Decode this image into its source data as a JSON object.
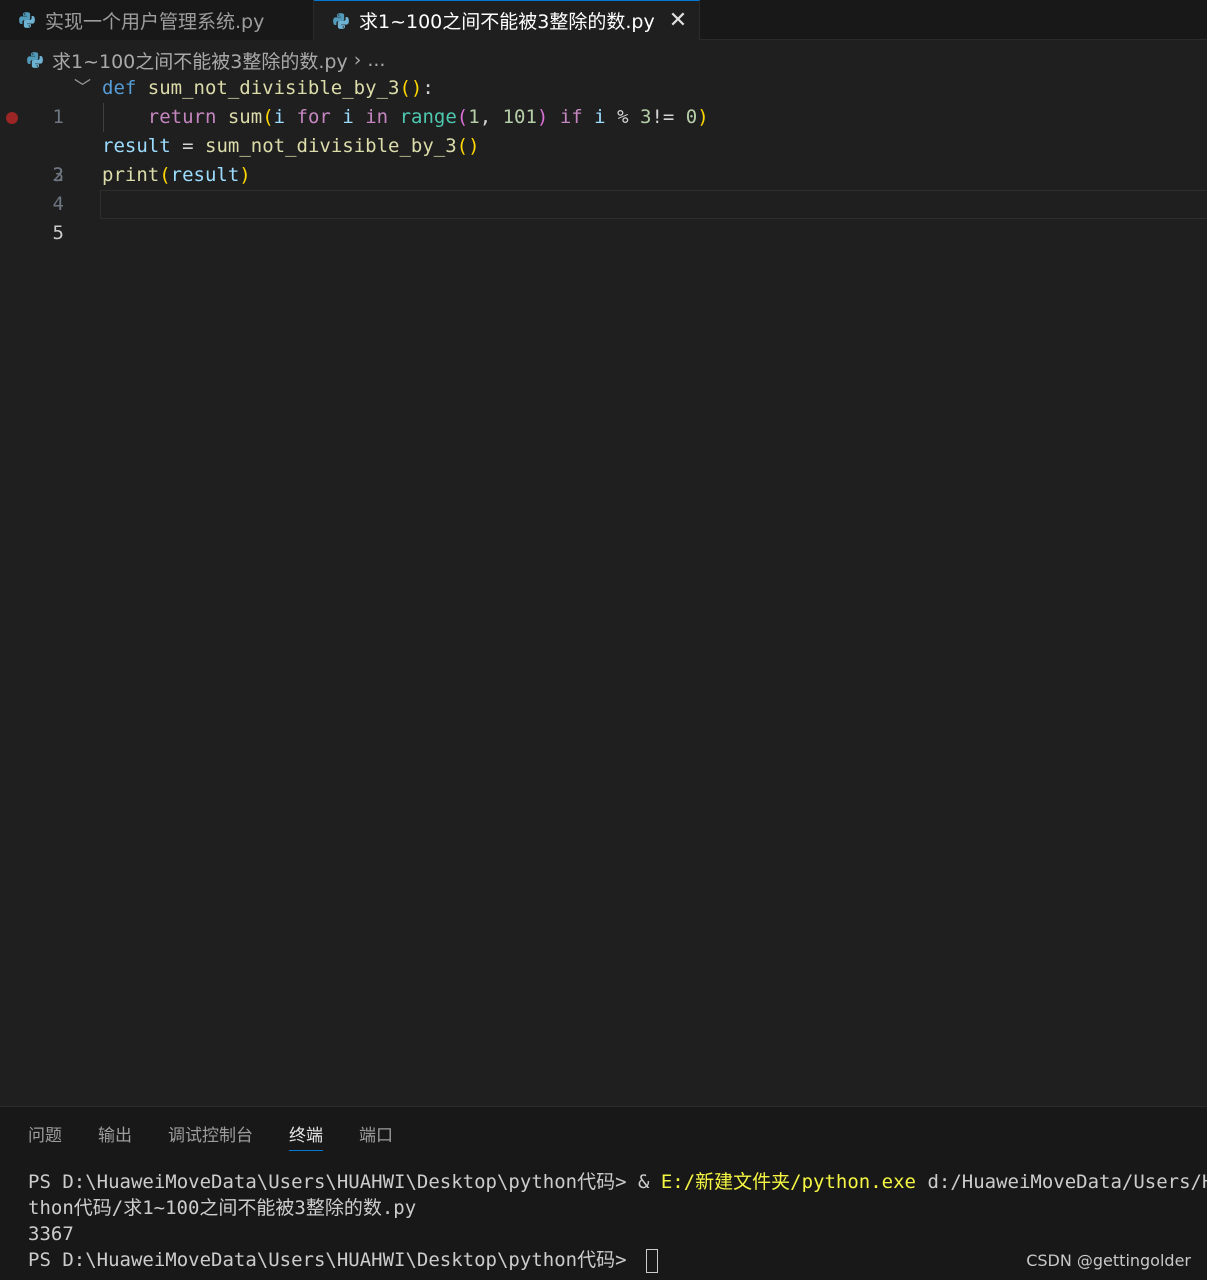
{
  "tabs": [
    {
      "label": "实现一个用户管理系统.py",
      "active": false
    },
    {
      "label": "求1~100之间不能被3整除的数.py",
      "active": true,
      "close_glyph": "✕"
    }
  ],
  "breadcrumb": {
    "file": "求1~100之间不能被3整除的数.py",
    "separator": "›",
    "more": "..."
  },
  "editor": {
    "line_numbers": [
      "1",
      "2",
      "3",
      "4",
      "5"
    ],
    "breakpoint_line": 2,
    "tokens": {
      "def": "def",
      "func_name": "sum_not_divisible_by_3",
      "paren_open": "(",
      "paren_close": ")",
      "colon": ":",
      "return": "return",
      "sum": "sum",
      "i": "i",
      "for": "for",
      "in": "in",
      "range": "range",
      "one": "1",
      "comma": ",",
      "hundred_one": "101",
      "if": "if",
      "mod": "%",
      "three": "3",
      "neq": "!=",
      "zero": "0",
      "result": "result",
      "eq": "=",
      "print": "print"
    }
  },
  "panel": {
    "tabs": [
      "问题",
      "输出",
      "调试控制台",
      "终端",
      "端口"
    ],
    "active_tab": "终端",
    "terminal": {
      "prompt": "PS D:\\HuaweiMoveData\\Users\\HUAHWI\\Desktop\\python代码> ",
      "cmd_amp": "& ",
      "cmd_exe": "E:/新建文件夹/python.exe",
      "cmd_arg": " d:/HuaweiMoveData/Users/HUAHWI/Desktop/py",
      "cmd_wrap": "thon代码/求1~100之间不能被3整除的数.py",
      "output": "3367",
      "prompt2": "PS D:\\HuaweiMoveData\\Users\\HUAHWI\\Desktop\\python代码> "
    }
  },
  "watermark": "CSDN @gettingolder",
  "colors": {
    "accent": "#0078d4",
    "background": "#1f1f1f",
    "breakpoint": "#9c2626"
  }
}
